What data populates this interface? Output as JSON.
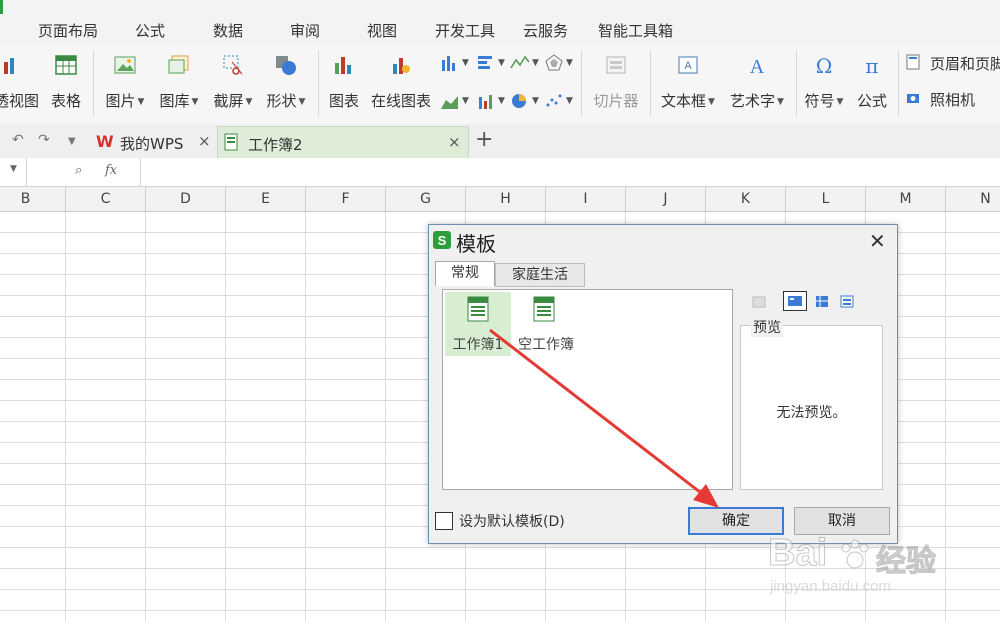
{
  "menu": {
    "tabs": [
      "页面布局",
      "公式",
      "数据",
      "审阅",
      "视图",
      "开发工具",
      "云服务",
      "智能工具箱"
    ]
  },
  "ribbon": {
    "pivot": "透视图",
    "table": "表格",
    "picture": "图片",
    "gallery": "图库",
    "screenshot": "截屏",
    "shapes": "形状",
    "chart": "图表",
    "online_chart": "在线图表",
    "slicer": "切片器",
    "textbox": "文本框",
    "wordart": "艺术字",
    "symbol": "符号",
    "formula": "公式",
    "header_footer": "页眉和页脚",
    "camera": "照相机"
  },
  "doc_tabs": {
    "tab1": "我的WPS",
    "tab2": "工作簿2"
  },
  "formula_bar": {
    "fx": "fx",
    "cell_ref": ""
  },
  "columns": [
    "B",
    "C",
    "D",
    "E",
    "F",
    "G",
    "H",
    "I",
    "J",
    "K",
    "L",
    "M",
    "N"
  ],
  "dialog": {
    "title": "模板",
    "tabs": [
      "常规",
      "家庭生活"
    ],
    "templates": [
      "工作簿1",
      "空工作簿"
    ],
    "preview_label": "预览",
    "no_preview": "无法预览。",
    "default_checkbox": "设为默认模板(D)",
    "ok": "确定",
    "cancel": "取消"
  },
  "watermark": {
    "brand": "Bai",
    "brand2": "经验",
    "url": "jingyan.baidu.com"
  },
  "colors": {
    "accent": "#2e9e3a",
    "arrow": "#e53935",
    "dialog_border": "#6e8fb3",
    "wps_red": "#d9322e"
  }
}
